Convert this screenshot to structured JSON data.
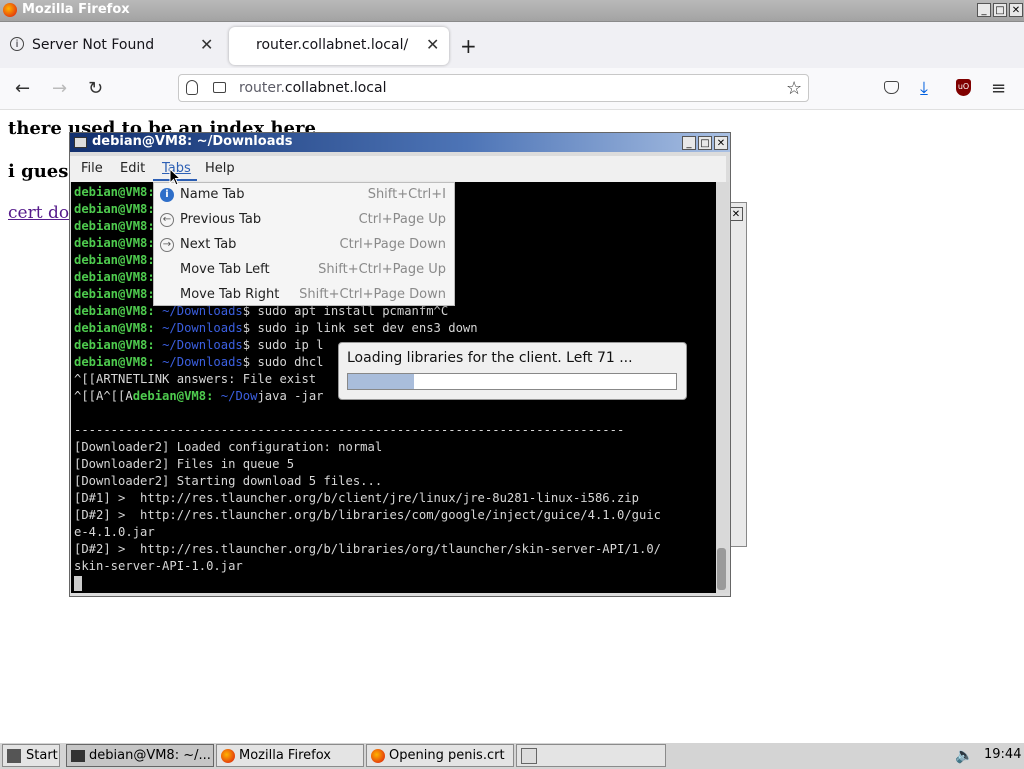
{
  "firefox": {
    "window_title": "Mozilla Firefox",
    "tabs": [
      {
        "label": "Server Not Found"
      },
      {
        "label": "router.collabnet.local/"
      }
    ],
    "url_host_prefix": "router.",
    "url_host_main": "collabnet.local"
  },
  "page": {
    "heading1": "there used to be an index here",
    "heading2": "i guess",
    "link_text": "cert dov"
  },
  "terminal": {
    "title": "debian@VM8: ~/Downloads",
    "menus": [
      "File",
      "Edit",
      "Tabs",
      "Help"
    ],
    "prompt_user": "debian@VM8:",
    "prompt_dir": "~/Downloads",
    "lines": {
      "l8": "$ sudo apt install pcmanfm^C",
      "l9": "$ sudo ip link set dev ens3 down",
      "l10": "$ sudo ip l",
      "l11": "$ sudo dhcl",
      "l12": "^[[ARTNETLINK answers: File exist",
      "l13_pre": "^[[A^[[A",
      "l13_dir": "~/Dow",
      "l13_post": "java -jar",
      "sep": "---------------------------------------------------------------------------",
      "d1": "[Downloader2] Loaded configuration: normal",
      "d2": "[Downloader2] Files in queue 5",
      "d3": "[Downloader2] Starting download 5 files...",
      "d4": "[D#1] >  http://res.tlauncher.org/b/client/jre/linux/jre-8u281-linux-i586.zip",
      "d5": "[D#2] >  http://res.tlauncher.org/b/libraries/com/google/inject/guice/4.1.0/guic",
      "d6": "e-4.1.0.jar",
      "d7": "[D#2] >  http://res.tlauncher.org/b/libraries/org/tlauncher/skin-server-API/1.0/",
      "d8": "skin-server-API-1.0.jar"
    }
  },
  "tabs_menu": {
    "items": [
      {
        "label": "Name Tab",
        "accel": "Shift+Ctrl+I",
        "icon": "info-icon"
      },
      {
        "label": "Previous Tab",
        "accel": "Ctrl+Page Up",
        "icon": "arrow-left-circle-icon"
      },
      {
        "label": "Next Tab",
        "accel": "Ctrl+Page Down",
        "icon": "arrow-right-circle-icon"
      },
      {
        "label": "Move Tab Left",
        "accel": "Shift+Ctrl+Page Up",
        "icon": ""
      },
      {
        "label": "Move Tab Right",
        "accel": "Shift+Ctrl+Page Down",
        "icon": ""
      }
    ]
  },
  "loading_dialog": {
    "text": "Loading libraries for the client. Left 71 ...",
    "progress": 0.2
  },
  "taskbar": {
    "start": "Start",
    "items": [
      "debian@VM8: ~/...",
      "Mozilla Firefox",
      "Opening penis.crt"
    ],
    "clock": "19:44"
  },
  "colors": {
    "prompt_green": "#4ecb4e",
    "prompt_blue": "#3b5fe0",
    "terminal_bg": "#000000",
    "progress_fill": "#a9bddb",
    "link_visited": "#551a8b"
  }
}
